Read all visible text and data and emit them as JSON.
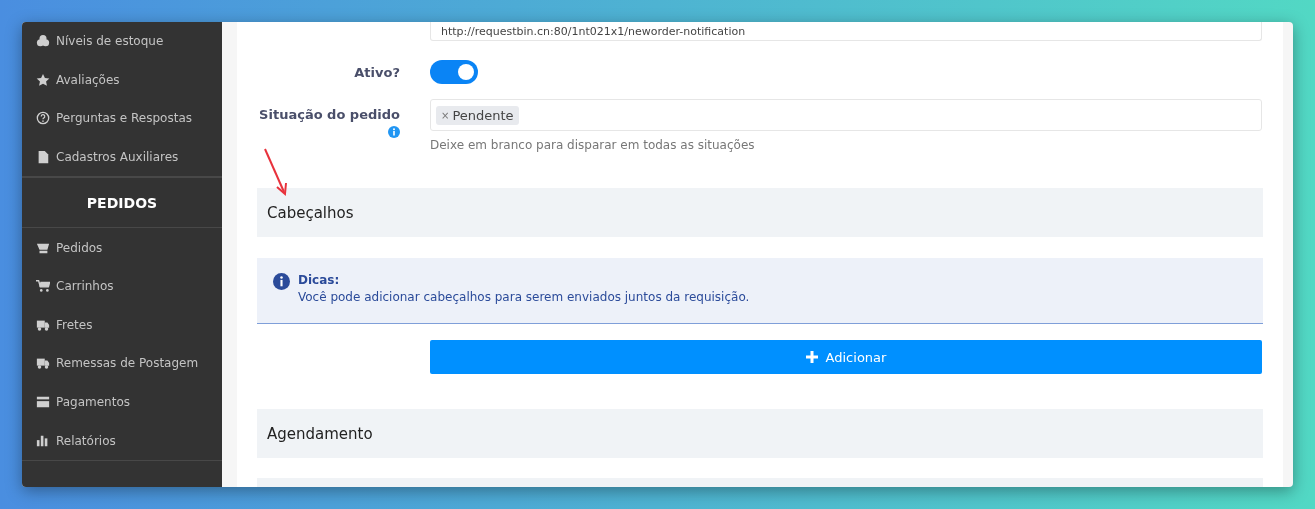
{
  "sidebar": {
    "groups": [
      {
        "items": [
          {
            "label": "Níveis de estoque"
          },
          {
            "label": "Avaliações"
          },
          {
            "label": "Perguntas e Respostas"
          },
          {
            "label": "Cadastros Auxiliares"
          }
        ]
      },
      {
        "heading": "PEDIDOS",
        "items": [
          {
            "label": "Pedidos"
          },
          {
            "label": "Carrinhos"
          },
          {
            "label": "Fretes"
          },
          {
            "label": "Remessas de Postagem"
          },
          {
            "label": "Pagamentos"
          },
          {
            "label": "Relatórios"
          }
        ]
      }
    ]
  },
  "form": {
    "url": {
      "value": "http://requestbin.cn:80/1nt021x1/neworder-notification"
    },
    "active": {
      "label": "Ativo?",
      "on": true
    },
    "status": {
      "label": "Situação do pedido",
      "tags": [
        {
          "remove": "×",
          "label": "Pendente"
        }
      ],
      "hint": "Deixe em branco para disparar em todas as situações"
    }
  },
  "headers_section": {
    "title": "Cabeçalhos",
    "tip": {
      "title": "Dicas:",
      "text": "Você pode adicionar cabeçalhos para serem enviados juntos da requisição."
    },
    "button": "Adicionar"
  },
  "schedule_section": {
    "title": "Agendamento"
  }
}
